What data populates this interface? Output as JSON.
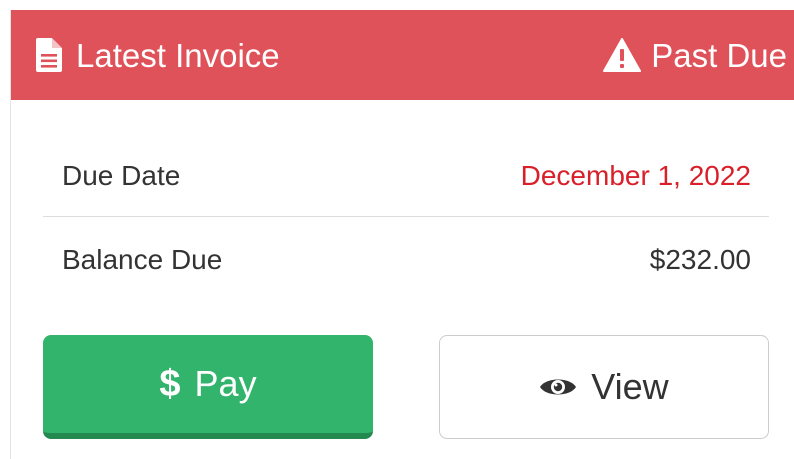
{
  "header": {
    "title": "Latest Invoice",
    "status": "Past Due",
    "background_color": "#e0525a",
    "title_icon": "document-icon",
    "status_icon": "warning-icon"
  },
  "details": {
    "due_date_label": "Due Date",
    "due_date_value": "December 1, 2022",
    "due_date_color": "#d9202a",
    "balance_label": "Balance Due",
    "balance_value": "$232.00"
  },
  "actions": {
    "pay_symbol": "$",
    "pay_label": "Pay",
    "pay_color": "#33b46c",
    "view_label": "View",
    "view_icon": "eye-icon"
  }
}
